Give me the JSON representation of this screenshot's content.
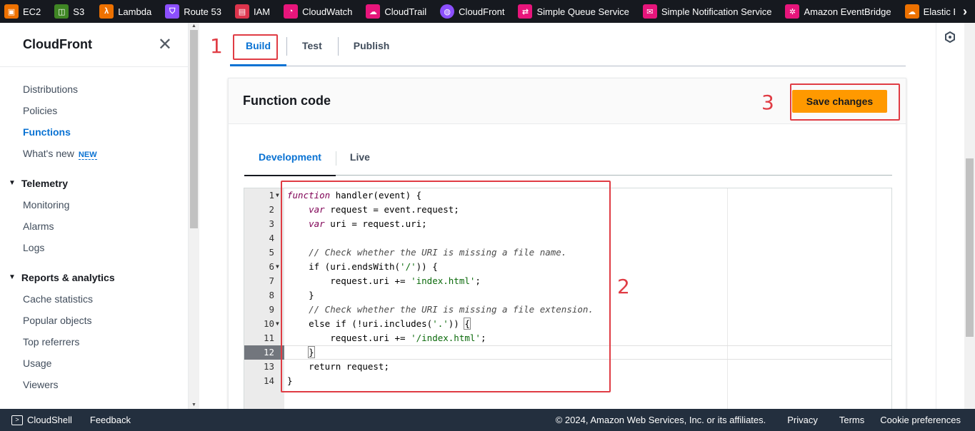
{
  "topbar": {
    "services": [
      {
        "label": "EC2",
        "icon": "ec2-icon",
        "color": "#ed7100"
      },
      {
        "label": "S3",
        "icon": "s3-icon",
        "color": "#3f8624"
      },
      {
        "label": "Lambda",
        "icon": "lambda-icon",
        "color": "#ed7100"
      },
      {
        "label": "Route 53",
        "icon": "route53-icon",
        "color": "#8c4fff"
      },
      {
        "label": "IAM",
        "icon": "iam-icon",
        "color": "#dd344c"
      },
      {
        "label": "CloudWatch",
        "icon": "cloudwatch-icon",
        "color": "#e7157b"
      },
      {
        "label": "CloudTrail",
        "icon": "cloudtrail-icon",
        "color": "#e7157b"
      },
      {
        "label": "CloudFront",
        "icon": "cloudfront-icon",
        "color": "#8c4fff"
      },
      {
        "label": "Simple Queue Service",
        "icon": "sqs-icon",
        "color": "#e7157b"
      },
      {
        "label": "Simple Notification Service",
        "icon": "sns-icon",
        "color": "#e7157b"
      },
      {
        "label": "Amazon EventBridge",
        "icon": "eventbridge-icon",
        "color": "#e7157b"
      },
      {
        "label": "Elastic Beans",
        "icon": "elastic-beanstalk-icon",
        "color": "#ed7100"
      }
    ]
  },
  "sidebar": {
    "title": "CloudFront",
    "items": [
      {
        "label": "Distributions"
      },
      {
        "label": "Policies"
      },
      {
        "label": "Functions"
      },
      {
        "label": "What's new",
        "badge": "NEW"
      }
    ],
    "sections": [
      {
        "label": "Telemetry",
        "items": [
          "Monitoring",
          "Alarms",
          "Logs"
        ]
      },
      {
        "label": "Reports & analytics",
        "items": [
          "Cache statistics",
          "Popular objects",
          "Top referrers",
          "Usage",
          "Viewers"
        ]
      }
    ]
  },
  "main": {
    "tabs": [
      "Build",
      "Test",
      "Publish"
    ],
    "card_title": "Function code",
    "save_label": "Save changes",
    "inner_tabs": [
      "Development",
      "Live"
    ],
    "code_lines": [
      "function handler(event) {",
      "    var request = event.request;",
      "    var uri = request.uri;",
      "",
      "    // Check whether the URI is missing a file name.",
      "    if (uri.endsWith('/')) {",
      "        request.uri += 'index.html';",
      "    }",
      "    // Check whether the URI is missing a file extension.",
      "    else if (!uri.includes('.')) {",
      "        request.uri += '/index.html';",
      "    }",
      "    return request;",
      "}"
    ],
    "current_line": 12
  },
  "callouts": [
    "1",
    "2",
    "3"
  ],
  "footer": {
    "cloudshell": "CloudShell",
    "feedback": "Feedback",
    "copyright": "© 2024, Amazon Web Services, Inc. or its affiliates.",
    "privacy": "Privacy",
    "terms": "Terms",
    "cookies": "Cookie preferences"
  },
  "colors": {
    "accent": "#0972d3",
    "primary_button": "#ff9900",
    "callout_red": "#e03c44",
    "topbar_bg": "#16191f",
    "footer_bg": "#232f3e"
  }
}
